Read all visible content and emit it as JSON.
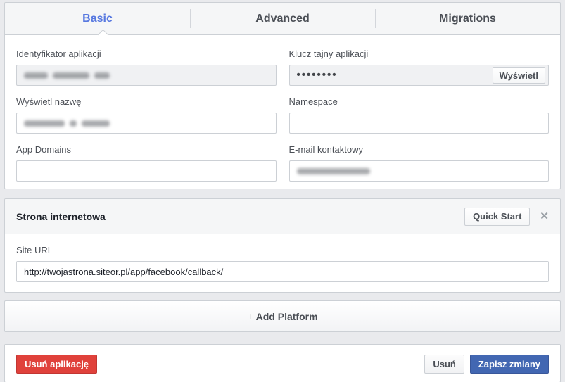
{
  "colors": {
    "page_background": "#e9eaed",
    "active_tab_blue": "#5778e0",
    "primary_blue": "#4267b2",
    "danger_red": "#e0413b"
  },
  "tabs": [
    {
      "label": "Basic",
      "active": true
    },
    {
      "label": "Advanced",
      "active": false
    },
    {
      "label": "Migrations",
      "active": false
    }
  ],
  "form": {
    "fields": [
      {
        "label": "Identyfikator aplikacji",
        "value": "",
        "redacted": true,
        "disabled": true
      },
      {
        "label": "Klucz tajny aplikacji",
        "value": "••••••••",
        "disabled": true,
        "button_label": "Wyświetl"
      },
      {
        "label": "Wyświetl nazwę",
        "value": "",
        "redacted": true
      },
      {
        "label": "Namespace",
        "value": ""
      },
      {
        "label": "App Domains",
        "value": ""
      },
      {
        "label": "E-mail kontaktowy",
        "value": "",
        "redacted": true
      }
    ]
  },
  "website": {
    "title": "Strona internetowa",
    "quick_start_label": "Quick Start",
    "close_icon": "✕",
    "site_url": {
      "label": "Site URL",
      "value": "http://twojastrona.siteor.pl/app/facebook/callback/"
    }
  },
  "add_platform": {
    "plus_icon": "+",
    "label": "Add Platform"
  },
  "actions": {
    "delete_app_label": "Usuń aplikację",
    "delete_label": "Usuń",
    "save_label": "Zapisz zmiany"
  }
}
